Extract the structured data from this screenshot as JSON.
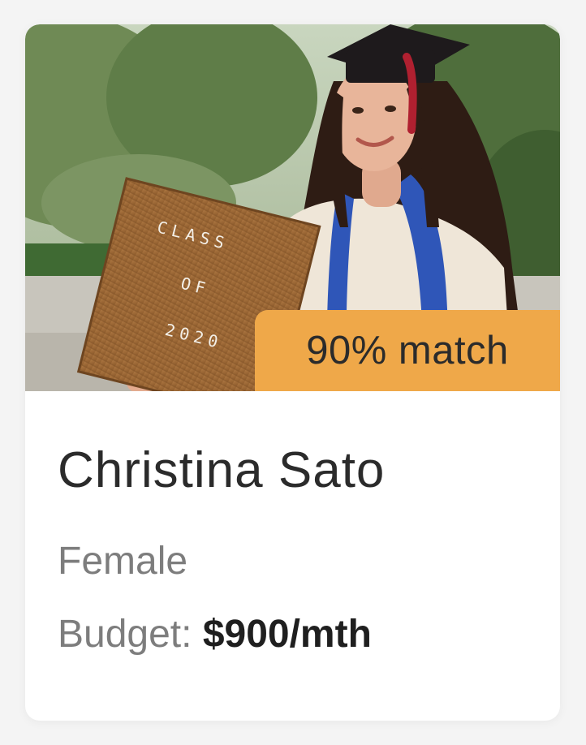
{
  "profile": {
    "match_label": "90% match",
    "name": "Christina Sato",
    "gender": "Female",
    "budget_label": "Budget:",
    "budget_value": "$900/mth",
    "photo_sign": {
      "line1": "CLASS",
      "line2": "OF",
      "line3": "2020"
    }
  },
  "colors": {
    "badge": "#efa849",
    "name_text": "#2b2b2b",
    "muted_text": "#7d7d7d"
  }
}
